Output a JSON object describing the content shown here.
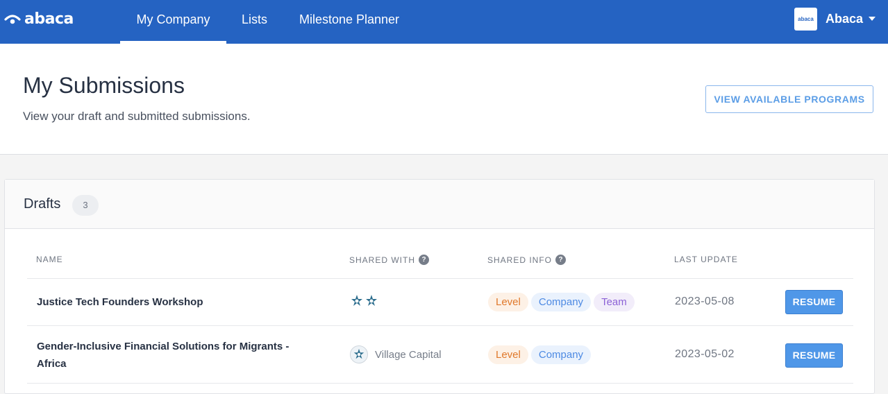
{
  "nav": {
    "logo_text": "abaca",
    "items": [
      {
        "label": "My Company",
        "active": true
      },
      {
        "label": "Lists",
        "active": false
      },
      {
        "label": "Milestone Planner",
        "active": false
      }
    ],
    "user": {
      "name": "Abaca",
      "avatar_text": "abaca"
    }
  },
  "header": {
    "title": "My Submissions",
    "subtitle": "View your draft and submitted submissions.",
    "view_programs_label": "VIEW AVAILABLE PROGRAMS"
  },
  "drafts": {
    "title": "Drafts",
    "count": "3",
    "columns": {
      "name": "NAME",
      "shared_with": "SHARED WITH",
      "shared_info": "SHARED INFO",
      "last_update": "LAST UPDATE"
    },
    "rows": [
      {
        "name": "Justice Tech Founders Workshop",
        "shared_with": "",
        "tags": [
          "Level",
          "Company",
          "Team"
        ],
        "last_update": "2023-05-08",
        "action": "RESUME"
      },
      {
        "name": "Gender-Inclusive Financial Solutions for Migrants - Africa",
        "shared_with": "Village Capital",
        "tags": [
          "Level",
          "Company"
        ],
        "last_update": "2023-05-02",
        "action": "RESUME"
      }
    ]
  },
  "colors": {
    "brand": "#2563c2",
    "button": "#4f97e8",
    "tag_level": "#e0782a",
    "tag_company": "#4d8ae3",
    "tag_team": "#8c62d6"
  }
}
